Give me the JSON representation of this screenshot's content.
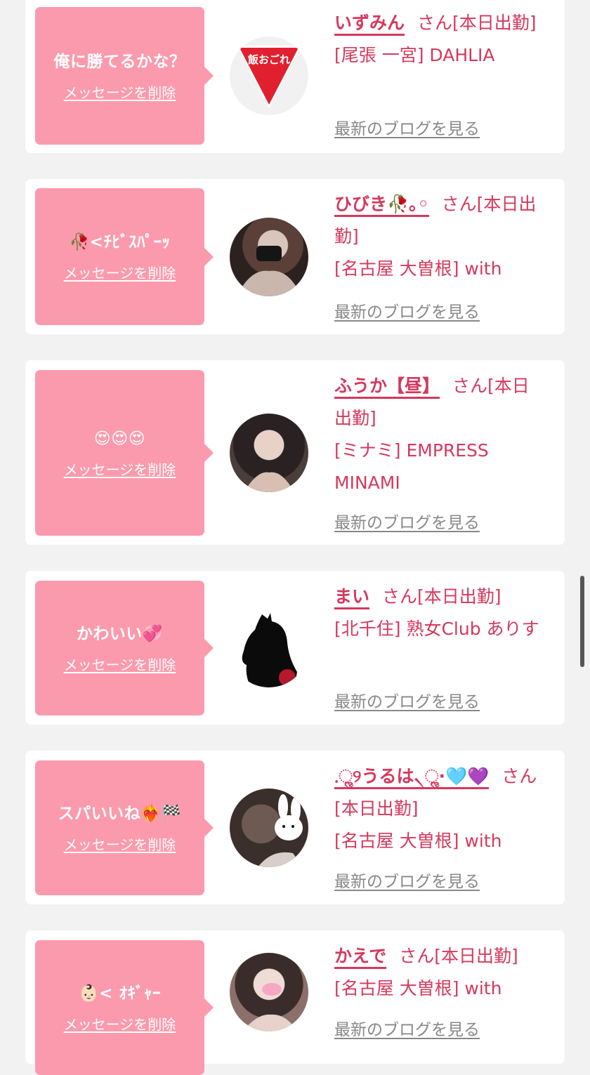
{
  "common": {
    "delete_label": "メッセージを削除",
    "blog_label": "最新のブログを見る"
  },
  "items": [
    {
      "message": "俺に勝てるかな？",
      "name": "いずみん",
      "meta": "さん[本日出勤]",
      "area": "[尾張 一宮] DAHLIA",
      "avatar_text": "飯おごれ"
    },
    {
      "message": "🥀<ﾁﾋﾞｽﾊﾟｰｯ",
      "name": "ひびき🥀｡◦",
      "meta": "さん[本日出勤]",
      "area": "[名古屋 大曽根] with"
    },
    {
      "message": "😍😍😍",
      "name": "ふうか【昼】",
      "meta": "さん[本日出勤]",
      "area": "[ミナミ] EMPRESS MINAMI"
    },
    {
      "message": "かわいい💞",
      "name": "まい",
      "meta": "さん[本日出勤]",
      "area": "[北千住] 熟女Club ありす"
    },
    {
      "message": "スパいいね❤️‍🔥🏁",
      "name": ".ૢ୨うるは৲ૢ·🩵💜",
      "meta": "さん[本日出勤]",
      "area": "[名古屋 大曽根] with"
    },
    {
      "message": "👶🏻< ｵｷﾞｬｰ",
      "name": "かえで",
      "meta": "さん[本日出勤]",
      "area": "[名古屋 大曽根] with"
    }
  ],
  "colors": {
    "accent": "#d6385c",
    "bubble": "#fc9aad",
    "background": "#f2f2f3",
    "card": "#ffffff",
    "link_gray": "#888888"
  }
}
